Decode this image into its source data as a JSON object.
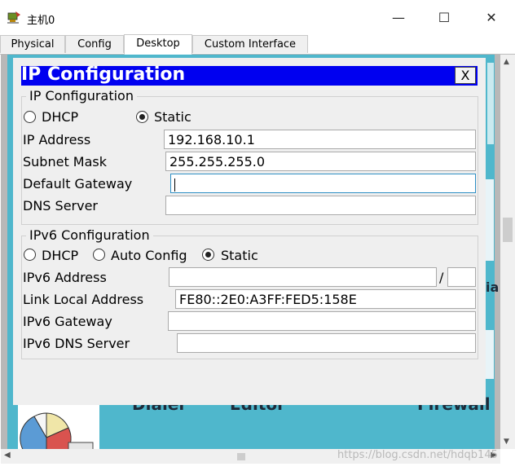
{
  "window": {
    "title": "主机0",
    "minimize_glyph": "—",
    "maximize_glyph": "☐",
    "close_glyph": "✕"
  },
  "tabs": [
    {
      "label": "Physical",
      "active": false
    },
    {
      "label": "Config",
      "active": false
    },
    {
      "label": "Desktop",
      "active": true
    },
    {
      "label": "Custom Interface",
      "active": false
    }
  ],
  "desktop": {
    "labels": [
      "Dialer",
      "Editor",
      "Firewall"
    ],
    "cut_text": "ia"
  },
  "ip_config": {
    "title": "IP Configuration",
    "close_label": "X",
    "ipv4": {
      "legend": "IP Configuration",
      "mode_dhcp": "DHCP",
      "mode_static": "Static",
      "selected_mode": "Static",
      "ip_address_label": "IP Address",
      "ip_address": "192.168.10.1",
      "subnet_mask_label": "Subnet Mask",
      "subnet_mask": "255.255.255.0",
      "gateway_label": "Default Gateway",
      "gateway": "",
      "dns_label": "DNS Server",
      "dns": ""
    },
    "ipv6": {
      "legend": "IPv6 Configuration",
      "mode_dhcp": "DHCP",
      "mode_auto": "Auto Config",
      "mode_static": "Static",
      "selected_mode": "Static",
      "address_label": "IPv6 Address",
      "address": "",
      "prefix_separator": "/",
      "prefix": "",
      "link_local_label": "Link Local Address",
      "link_local": "FE80::2E0:A3FF:FED5:158E",
      "gateway_label": "IPv6 Gateway",
      "gateway": "",
      "dns_label": "IPv6 DNS Server",
      "dns": ""
    }
  },
  "watermark": "https://blog.csdn.net/hdqb145",
  "colors": {
    "header_blue": "#0000f0",
    "desktop_teal": "#4fb7cc",
    "panel_bg": "#efefef"
  }
}
